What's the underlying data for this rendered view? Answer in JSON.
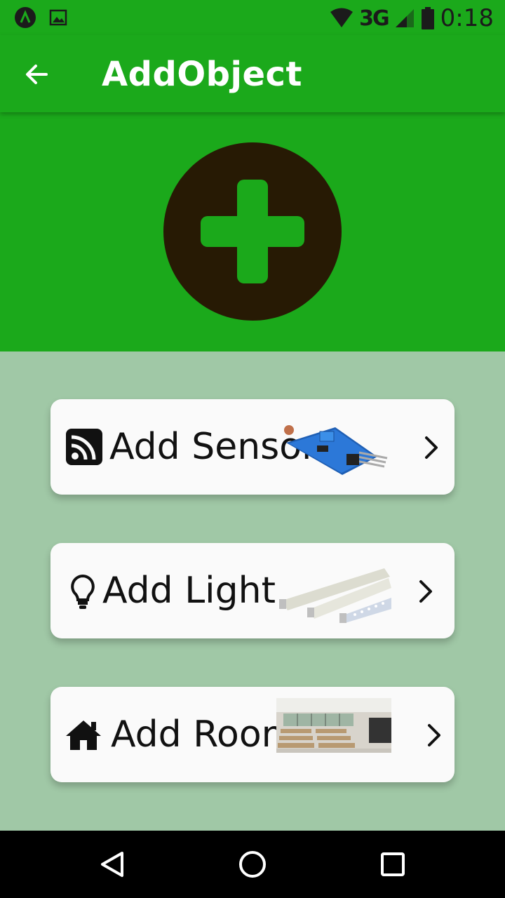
{
  "status_bar": {
    "network": "3G",
    "time": "0:18",
    "icons": [
      "app-notification-icon",
      "image-notification-icon",
      "wifi-icon",
      "cell-signal-icon",
      "battery-icon"
    ]
  },
  "app_bar": {
    "title": "AddObject",
    "back_icon": "arrow-left-icon"
  },
  "hero": {
    "icon": "add-circle-icon"
  },
  "cards": [
    {
      "label": "Add Sensor",
      "icon": "rss-icon",
      "thumbnail": "sensor-module-image"
    },
    {
      "label": "Add Light",
      "icon": "lightbulb-icon",
      "thumbnail": "led-tubes-image"
    },
    {
      "label": "Add Room",
      "icon": "home-icon",
      "thumbnail": "classroom-image"
    }
  ],
  "nav_bar": {
    "buttons": [
      "back-triangle-icon",
      "home-circle-icon",
      "recents-square-icon"
    ]
  },
  "colors": {
    "primary_green": "#1ba91b",
    "background": "#a0c8a6",
    "card": "#fafafa",
    "circle": "#271a04"
  }
}
